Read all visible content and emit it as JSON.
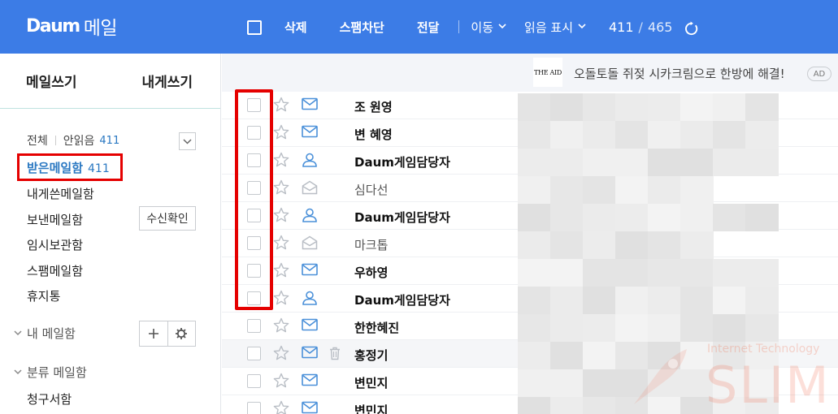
{
  "app": {
    "logo_brand": "Daum",
    "logo_product": "메일"
  },
  "toolbar": {
    "select_all": "select-all",
    "delete": "삭제",
    "spam_block": "스팸차단",
    "forward": "전달",
    "move": "이동",
    "read_mark": "읽음 표시",
    "count_current": "411",
    "count_separator": "/",
    "count_total": "465"
  },
  "sidebar": {
    "compose": "메일쓰기",
    "to_self": "내게쓰기",
    "filter_all": "전체",
    "filter_unread": "안읽음",
    "filter_unread_count": "411",
    "folders": [
      {
        "label": "받은메일함",
        "count": "411",
        "active": true
      },
      {
        "label": "내게쓴메일함"
      },
      {
        "label": "보낸메일함"
      },
      {
        "label": "임시보관함"
      },
      {
        "label": "스팸메일함"
      },
      {
        "label": "휴지통"
      }
    ],
    "receipt_check": "수신확인",
    "my_mailboxes": "내 메일함",
    "category_mailboxes": "분류 메일함",
    "billing": "청구서함"
  },
  "ad": {
    "logo_text": "THE AID",
    "text": "오돌토돌 쥐젖 시카크림으로 한방에 해결!",
    "badge": "AD"
  },
  "mails": [
    {
      "sender": "조 원영",
      "icon": "envelope-icon",
      "unread": true
    },
    {
      "sender": "변 혜영",
      "icon": "envelope-icon",
      "unread": true
    },
    {
      "sender": "Daum게임담당자",
      "icon": "person-icon",
      "unread": true
    },
    {
      "sender": "심다선",
      "icon": "open-envelope-icon",
      "unread": false
    },
    {
      "sender": "Daum게임담당자",
      "icon": "person-icon",
      "unread": true
    },
    {
      "sender": "마크톱",
      "icon": "open-envelope-icon",
      "unread": false
    },
    {
      "sender": "우하영",
      "icon": "envelope-icon",
      "unread": true
    },
    {
      "sender": "Daum게임담당자",
      "icon": "person-icon",
      "unread": true
    },
    {
      "sender": "한한혜진",
      "icon": "envelope-icon",
      "unread": true
    },
    {
      "sender": "홍정기",
      "icon": "envelope-icon",
      "unread": true,
      "hover": true
    },
    {
      "sender": "변민지",
      "icon": "envelope-icon",
      "unread": true
    },
    {
      "sender": "변민지",
      "icon": "envelope-icon",
      "unread": true
    }
  ],
  "watermark": {
    "tagline": "Internet Technology",
    "name": "SLIM"
  },
  "colors": {
    "topbar": "#3c7ce6",
    "accent": "#2a78c2",
    "highlight": "#e50000",
    "icon_blue": "#4a90d9",
    "icon_gray": "#b9bec5"
  }
}
